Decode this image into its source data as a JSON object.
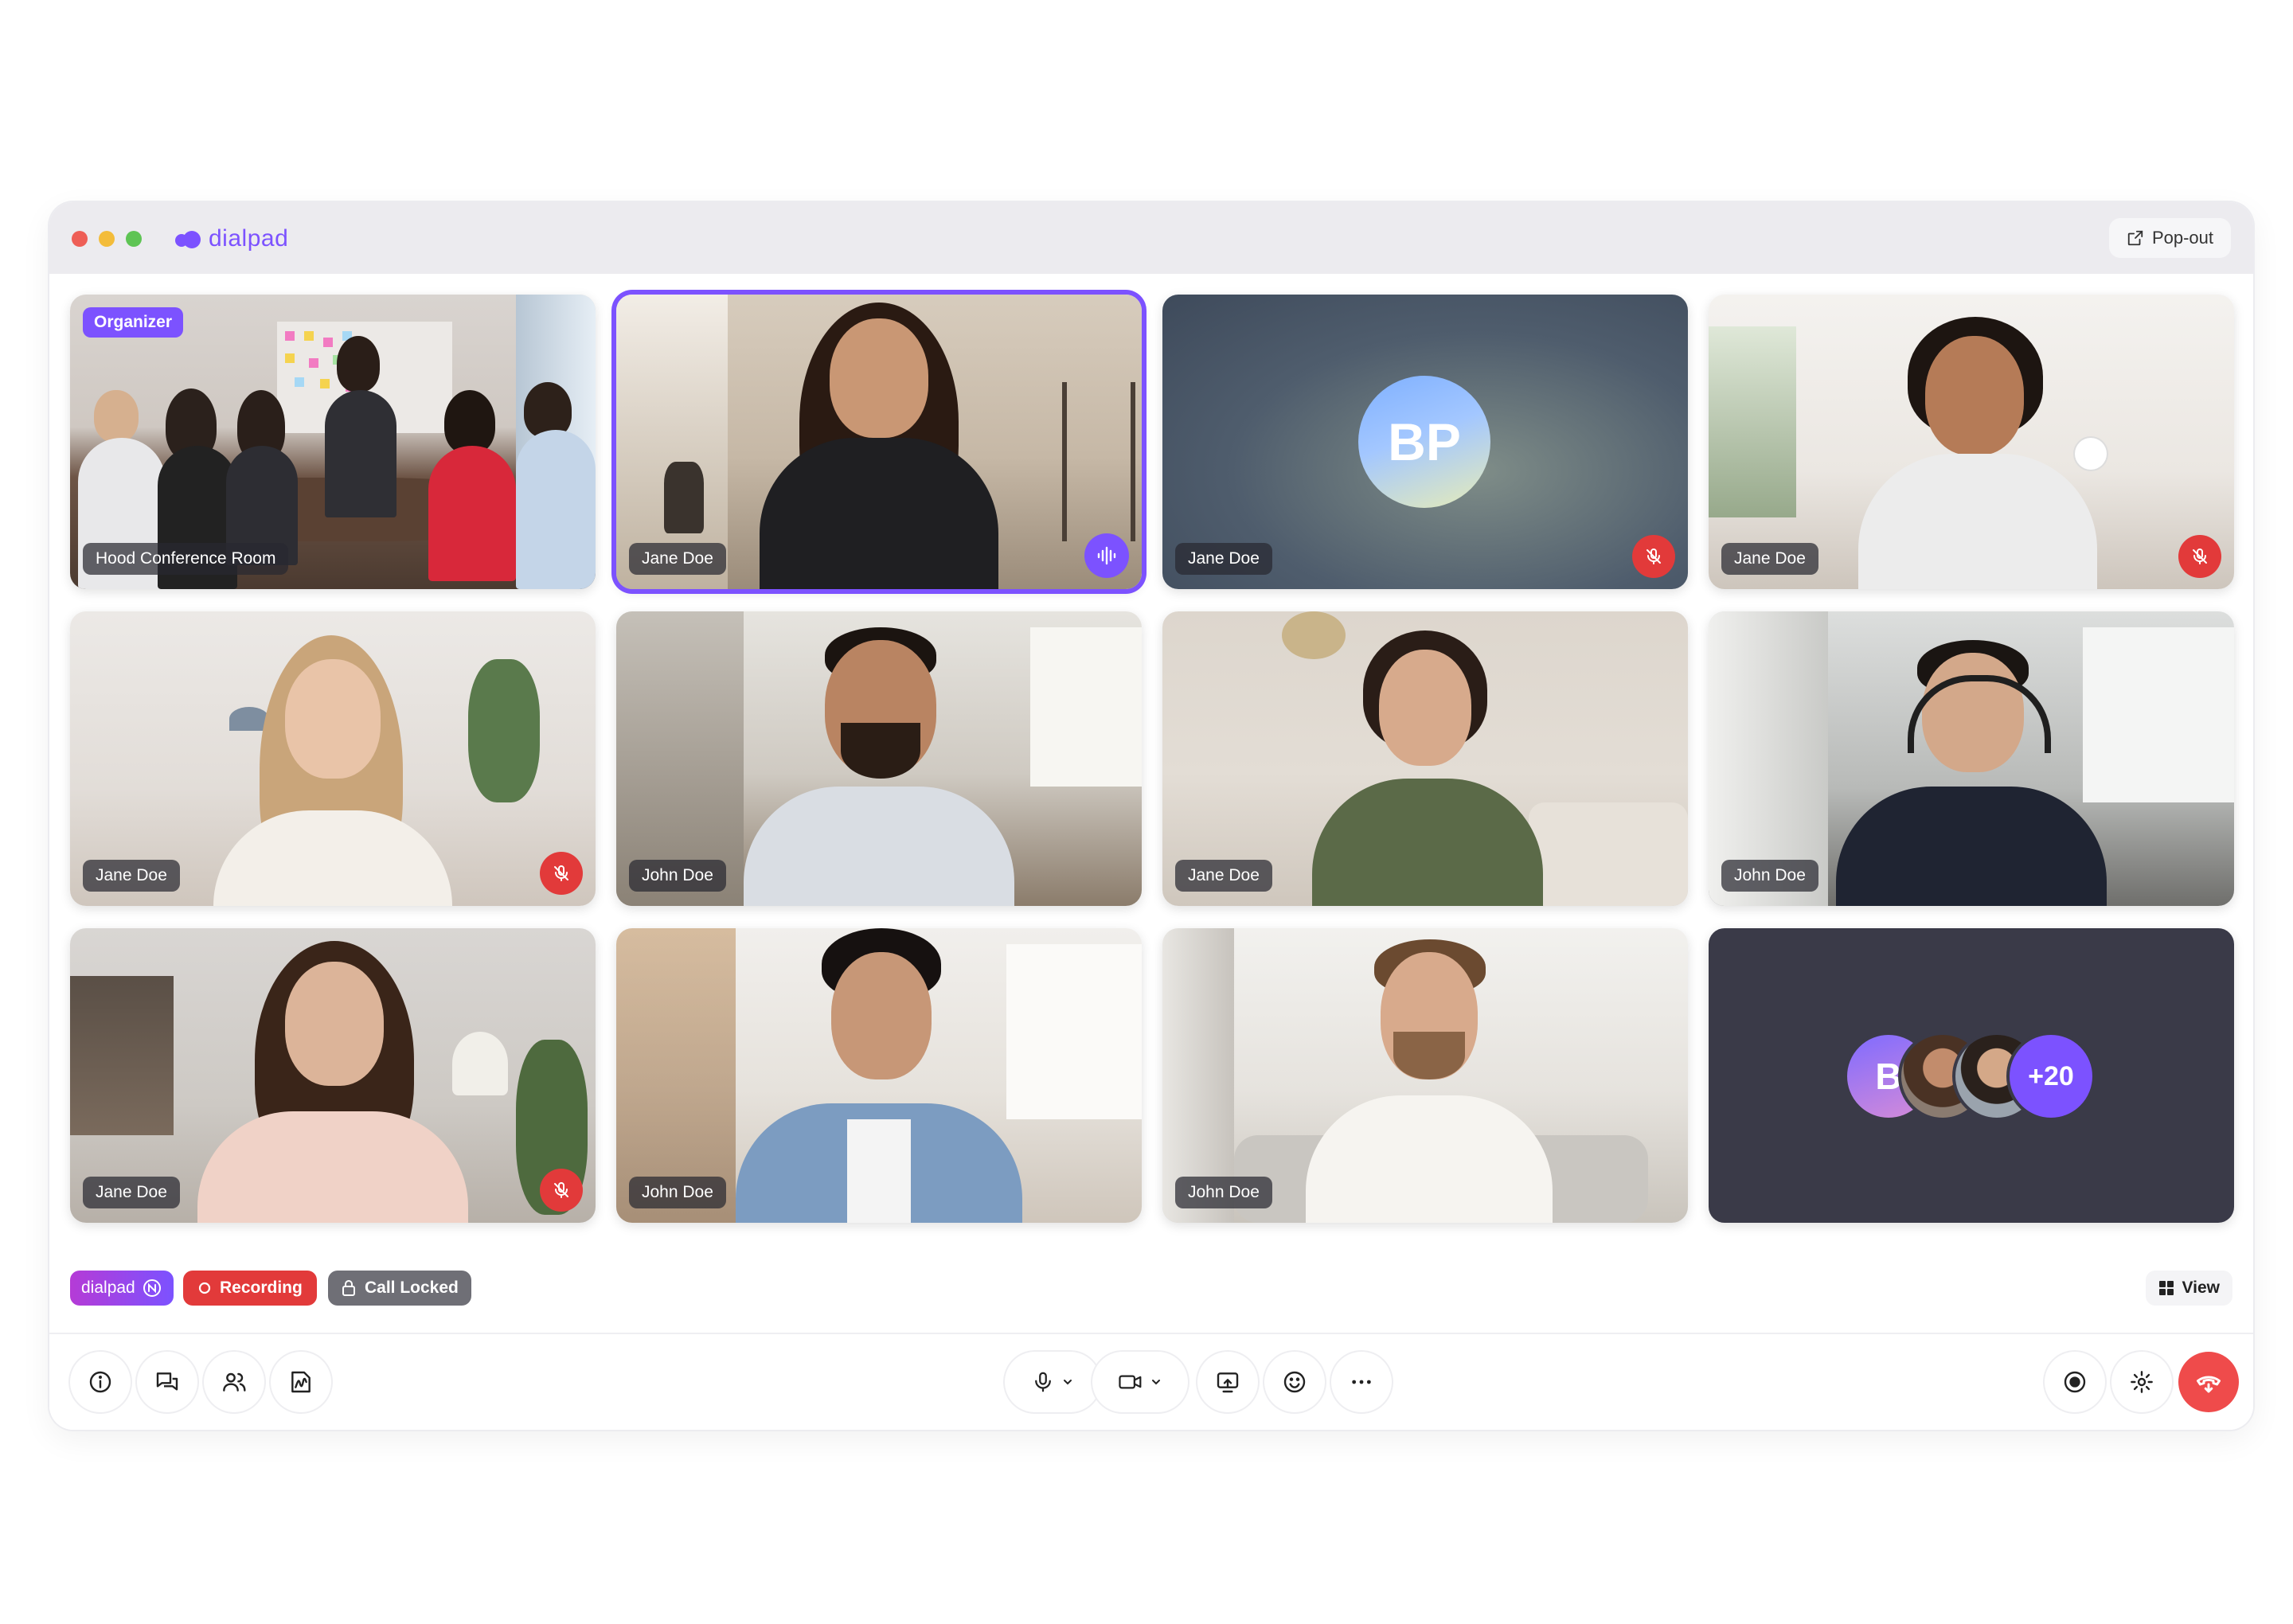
{
  "app": {
    "brand": "dialpad",
    "popout_label": "Pop-out"
  },
  "colors": {
    "accent": "#7c52ff",
    "danger": "#e23a3a",
    "titlebar": "#ecebef"
  },
  "tiles": [
    {
      "name": "Hood Conference Room",
      "badge": "Organizer",
      "muted": false,
      "speaking": false
    },
    {
      "name": "Jane Doe",
      "muted": false,
      "speaking": true
    },
    {
      "name": "Jane Doe",
      "avatar_initials": "BP",
      "muted": true,
      "speaking": false
    },
    {
      "name": "Jane Doe",
      "muted": true,
      "speaking": false
    },
    {
      "name": "Jane Doe",
      "muted": true,
      "speaking": false
    },
    {
      "name": "John Doe",
      "muted": false,
      "speaking": false
    },
    {
      "name": "Jane Doe",
      "muted": false,
      "speaking": false
    },
    {
      "name": "John Doe",
      "muted": false,
      "speaking": false
    },
    {
      "name": "Jane Doe",
      "muted": true,
      "speaking": false
    },
    {
      "name": "John Doe",
      "muted": false,
      "speaking": false
    },
    {
      "name": "John Doe",
      "muted": false,
      "speaking": false
    },
    {
      "overflow_initials": "B",
      "overflow_count": "+20"
    }
  ],
  "status": {
    "ai_badge": "dialpad",
    "ai_badge_icon": "ai-icon",
    "recording_label": "Recording",
    "locked_label": "Call Locked",
    "view_label": "View"
  },
  "toolbar": {
    "left": [
      "info-icon",
      "chat-icon",
      "participants-icon",
      "whiteboard-icon"
    ],
    "center": [
      "microphone-icon",
      "camera-icon",
      "share-screen-icon",
      "emoji-icon",
      "more-icon"
    ],
    "right": [
      "record-icon",
      "settings-icon",
      "leave-call-icon"
    ]
  }
}
